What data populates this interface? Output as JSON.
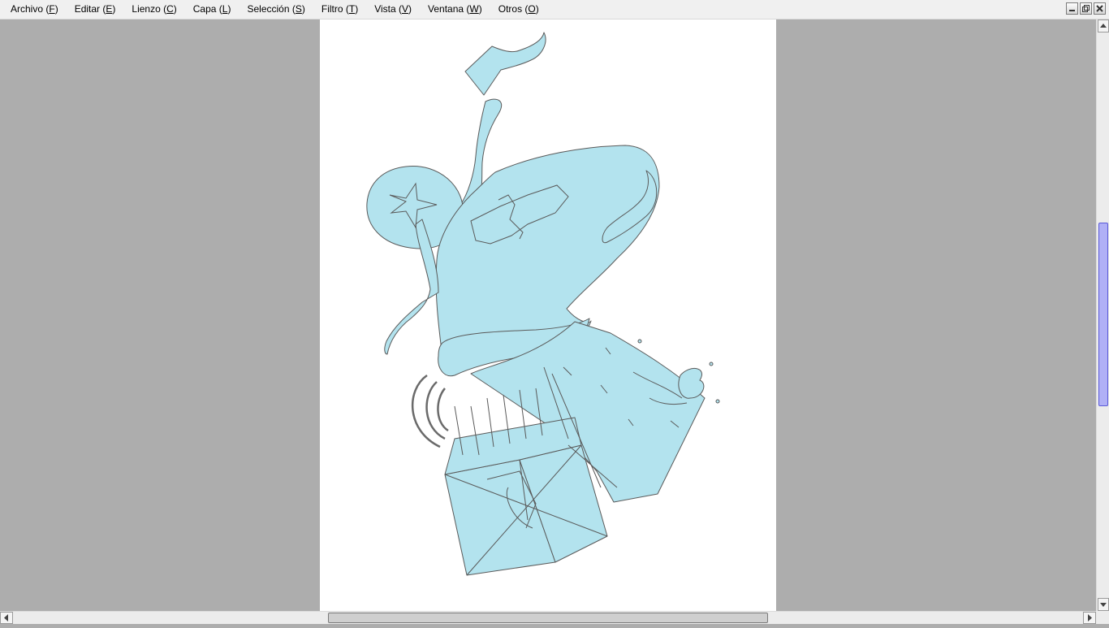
{
  "menu": {
    "items": [
      {
        "label": "Archivo (",
        "acc": "F",
        "end": ")"
      },
      {
        "label": "Editar (",
        "acc": "E",
        "end": ")"
      },
      {
        "label": "Lienzo (",
        "acc": "C",
        "end": ")"
      },
      {
        "label": "Capa (",
        "acc": "L",
        "end": ")"
      },
      {
        "label": "Selección (",
        "acc": "S",
        "end": ")"
      },
      {
        "label": "Filtro (",
        "acc": "T",
        "end": ")"
      },
      {
        "label": "Vista (",
        "acc": "V",
        "end": ")"
      },
      {
        "label": "Ventana (",
        "acc": "W",
        "end": ")"
      },
      {
        "label": "Otros (",
        "acc": "O",
        "end": ")"
      }
    ]
  },
  "window_controls": {
    "icons": [
      "minimize-icon",
      "restore-icon",
      "close-icon"
    ]
  },
  "canvas": {
    "fill_color": "#b3e3ee",
    "stroke_color": "#5a5a5a",
    "page_color": "#ffffff",
    "workspace_color": "#adadad"
  },
  "scrollbars": {
    "vertical_thumb_color": "#b0b0f6",
    "icons": [
      "arrow-up-icon",
      "arrow-down-icon",
      "arrow-left-icon",
      "arrow-right-icon"
    ]
  }
}
